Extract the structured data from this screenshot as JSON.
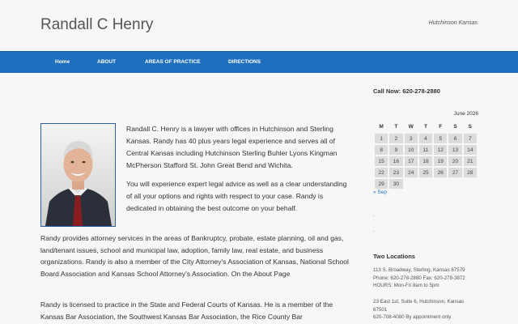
{
  "header": {
    "site_title": "Randall C Henry",
    "tagline": "Hutchinson Kansas"
  },
  "nav": {
    "items": [
      {
        "label": "Home"
      },
      {
        "label": "ABOUT"
      },
      {
        "label": "AREAS OF PRACTICE"
      },
      {
        "label": "DIRECTIONS"
      }
    ]
  },
  "main": {
    "paragraphs": [
      "Randall C. Henry is a lawyer with offices in Hutchinson and Sterling Kansas. Randy has 40 plus years legal experience and serves all of Central Kansas including Hutchinson Sterling Buhler Lyons Kingman McPherson Stafford St. John Great Bend and Wichita.",
      "You will experience expert legal advice as well as a clear understanding of all your options and rights with respect to your case. Randy is dedicated in obtaining the best outcome on your behalf.",
      "Randy provides attorney services in the areas of Bankruptcy, probate, estate planning, oil and gas, land/tenant issues, school and municipal law, adoption, family law, real estate, and business organizations. Randy is also a member of the City Attorney's Association of Kansas, National School Board Association and Kansas School Attorney's Association. On the About Page",
      "Randy is licensed to practice in the State and Federal Courts of Kansas. He is a member of the Kansas Bar Association, the Southwest Kansas Bar Association, the Rice County Bar"
    ]
  },
  "sidebar": {
    "call_now": "Call Now: 620-278-2880",
    "calendar": {
      "caption": "June 2026",
      "weekdays": [
        "M",
        "T",
        "W",
        "T",
        "F",
        "S",
        "S"
      ],
      "weeks": [
        [
          "1",
          "2",
          "3",
          "4",
          "5",
          "6",
          "7"
        ],
        [
          "8",
          "9",
          "10",
          "11",
          "12",
          "13",
          "14"
        ],
        [
          "15",
          "16",
          "17",
          "18",
          "19",
          "20",
          "21"
        ],
        [
          "22",
          "23",
          "24",
          "25",
          "26",
          "27",
          "28"
        ],
        [
          "29",
          "30",
          "",
          "",
          "",
          "",
          ""
        ]
      ],
      "prev_label": "« Sep"
    },
    "bullets": [
      ".",
      "."
    ],
    "locations_title": "Two Locations",
    "locations": [
      [
        "113 S. Broadway, Sterling, Kansas 67579",
        "Phone: 620-278-2880 Fax: 620-278-3872",
        "HOURS: Mon-Fri 8am to 5pm"
      ],
      [
        "23 East 1st, Suite 6, Hutchinson, Kansas",
        "67501",
        "620-708-4080 By appointment only"
      ]
    ]
  }
}
